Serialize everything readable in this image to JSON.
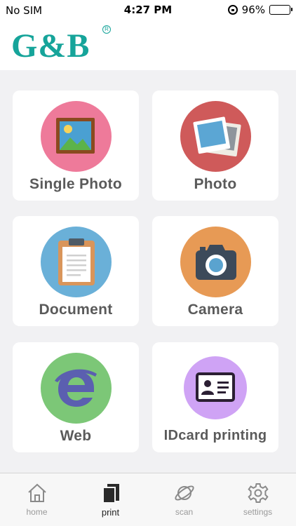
{
  "status_bar": {
    "carrier": "No SIM",
    "time": "4:27 PM",
    "battery": "96%",
    "battery_level": 0.96
  },
  "header": {
    "logo_text": "G&B",
    "logo_registered": "R",
    "brand_color": "#16a49a"
  },
  "grid": {
    "items": [
      {
        "label": "Single Photo",
        "icon": "framed-picture-icon",
        "color": "#ee7a9a"
      },
      {
        "label": "Photo",
        "icon": "photos-stack-icon",
        "color": "#cf5a5a"
      },
      {
        "label": "Document",
        "icon": "clipboard-icon",
        "color": "#6ab0d8"
      },
      {
        "label": "Camera",
        "icon": "camera-icon",
        "color": "#e79a55"
      },
      {
        "label": "Web",
        "icon": "browser-e-icon",
        "color": "#7cc777"
      },
      {
        "label": "IDcard printing",
        "icon": "id-card-icon",
        "color": "#cfa3f5"
      }
    ]
  },
  "tab_bar": {
    "tabs": [
      {
        "label": "home",
        "icon": "home-icon",
        "active": false
      },
      {
        "label": "print",
        "icon": "print-icon",
        "active": true
      },
      {
        "label": "scan",
        "icon": "planet-icon",
        "active": false
      },
      {
        "label": "settings",
        "icon": "gear-icon",
        "active": false
      }
    ]
  }
}
